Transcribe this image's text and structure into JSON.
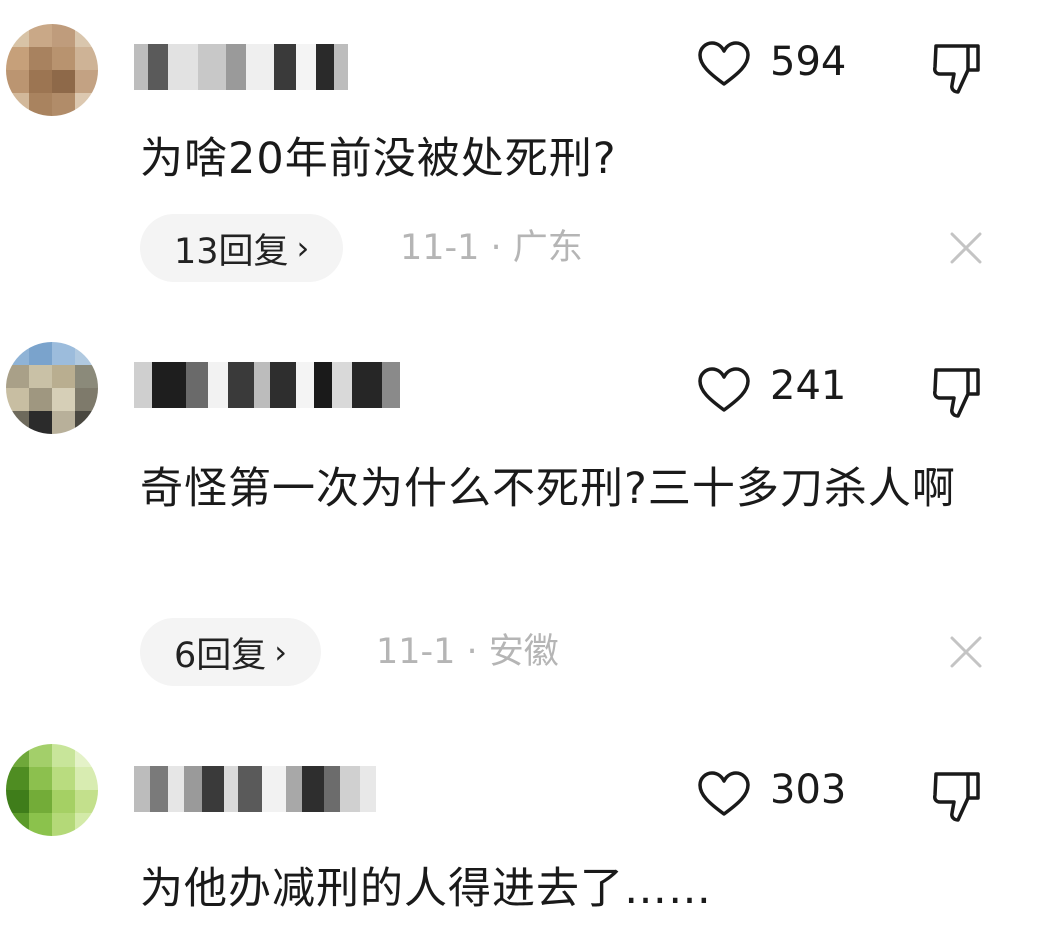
{
  "comments": [
    {
      "likes": "594",
      "text": "为啥20年前没被处死刑?",
      "reply_label": "13回复",
      "reply_chevron": "›",
      "meta": "11-1 · 广东"
    },
    {
      "likes": "241",
      "text": "奇怪第一次为什么不死刑?三十多刀杀人啊",
      "reply_label": "6回复",
      "reply_chevron": "›",
      "meta": "11-1 · 安徽"
    },
    {
      "likes": "303",
      "text": "为他办减刑的人得进去了……"
    }
  ],
  "icons": {
    "like": "heart-outline-icon",
    "dislike": "thumbs-down-outline-icon",
    "close": "close-icon"
  },
  "colors": {
    "text": "#1a1a1a",
    "meta": "#b5b5b5",
    "reply_bg": "#f4f4f4"
  }
}
